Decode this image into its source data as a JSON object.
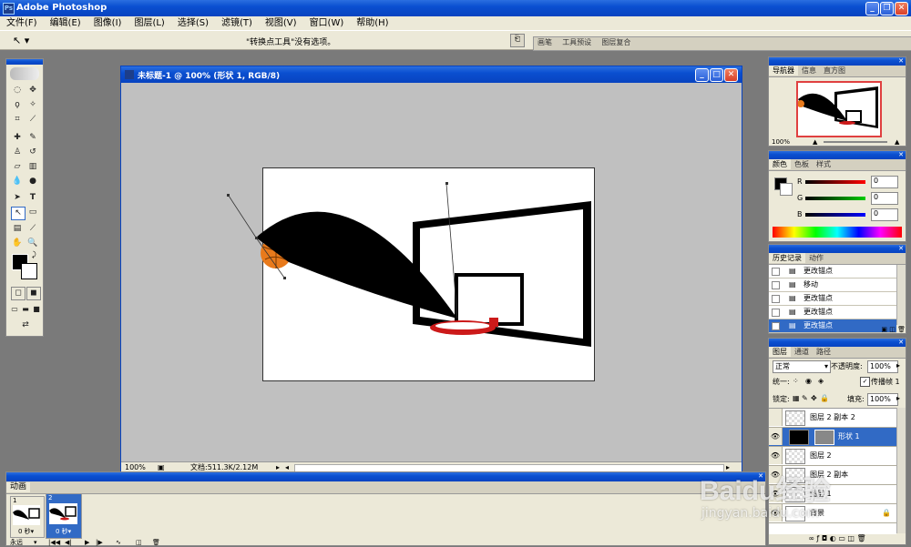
{
  "app": {
    "title": "Adobe Photoshop"
  },
  "menu": [
    "文件(F)",
    "编辑(E)",
    "图像(I)",
    "图层(L)",
    "选择(S)",
    "滤镜(T)",
    "视图(V)",
    "窗口(W)",
    "帮助(H)"
  ],
  "options_bar": {
    "tool_icon": "convert-point-icon",
    "message": "\"转换点工具\"没有选项。",
    "palette_well_tabs": [
      "画笔",
      "工具预设",
      "图层复合"
    ]
  },
  "document": {
    "title": "未标题-1 @ 100% (形状 1, RGB/8)",
    "zoom": "100%",
    "doc_info": "文档:511.3K/2.12M"
  },
  "navigator": {
    "tabs": [
      "导航器",
      "信息",
      "直方图"
    ],
    "zoom": "100%"
  },
  "color_panel": {
    "tabs": [
      "颜色",
      "色板",
      "样式"
    ],
    "r_label": "R",
    "g_label": "G",
    "b_label": "B",
    "r": "0",
    "g": "0",
    "b": "0",
    "foreground": "#000000",
    "background": "#ffffff"
  },
  "history": {
    "tabs": [
      "历史记录",
      "动作"
    ],
    "items": [
      "更改锚点",
      "移动",
      "更改锚点",
      "更改锚点",
      "更改锚点"
    ],
    "selected_index": 4
  },
  "layers": {
    "tabs": [
      "图层",
      "通道",
      "路径"
    ],
    "blend_mode": "正常",
    "opacity_label": "不透明度:",
    "opacity": "100%",
    "unify_label": "统一:",
    "propagate_label": "传播帧 1",
    "lock_label": "锁定:",
    "fill_label": "填充:",
    "fill": "100%",
    "rows": [
      {
        "name": "图层 2 副本 2",
        "visible": false,
        "selected": false
      },
      {
        "name": "形状 1",
        "visible": true,
        "selected": true
      },
      {
        "name": "图层 2",
        "visible": true,
        "selected": false
      },
      {
        "name": "图层 2 副本",
        "visible": true,
        "selected": false
      },
      {
        "name": "图层 1",
        "visible": true,
        "selected": false
      },
      {
        "name": "背景",
        "visible": true,
        "selected": false
      }
    ]
  },
  "animation": {
    "tab": "动画",
    "frames": [
      {
        "num": "1",
        "delay": "0 秒▾"
      },
      {
        "num": "2",
        "delay": "0 秒▾"
      }
    ],
    "loop": "永远"
  },
  "watermark": {
    "text": "Baidu经验",
    "url": "jingyan.baidu.com"
  },
  "colors": {
    "titlebar": "#0a4fd0",
    "selection": "#316ac5",
    "ball": "#e87a1c",
    "hoop": "#cc1a1a"
  }
}
